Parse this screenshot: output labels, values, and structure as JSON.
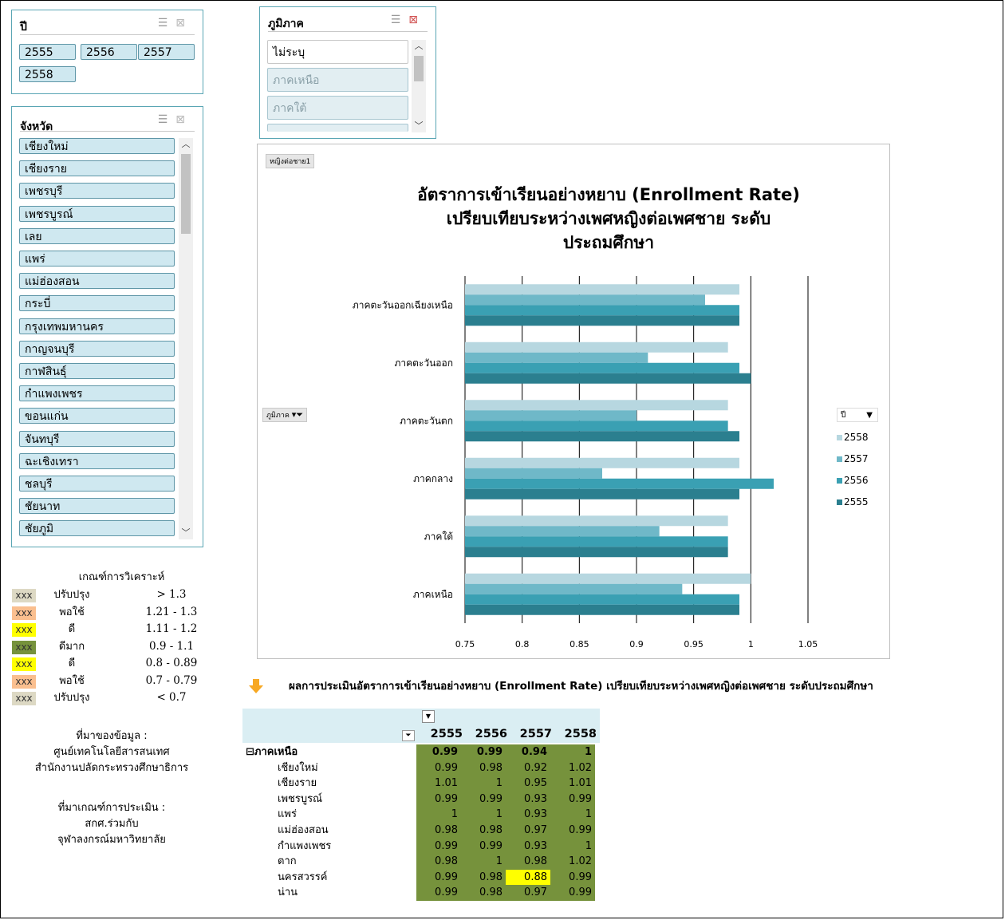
{
  "slicers": {
    "year": {
      "title": "ปี",
      "items": [
        "2555",
        "2556",
        "2557",
        "2558"
      ]
    },
    "region": {
      "title": "ภูมิภาค",
      "items": [
        "ไม่ระบุ",
        "ภาคเหนือ",
        "ภาคใต้"
      ]
    },
    "province": {
      "title": "จังหวัด",
      "items": [
        "เชียงใหม่",
        "เชียงราย",
        "เพชรบุรี",
        "เพชรบูรณ์",
        "เลย",
        "แพร่",
        "แม่ฮ่องสอน",
        "กระบี่",
        "กรุงเทพมหานคร",
        "กาญจนบุรี",
        "กาฬสินธุ์",
        "กำแพงเพชร",
        "ขอนแก่น",
        "จันทบุรี",
        "ฉะเชิงเทรา",
        "ชลบุรี",
        "ชัยนาท",
        "ชัยภูมิ"
      ]
    }
  },
  "criteria": {
    "title": "เกณฑ์การวิเคราะห์",
    "swatch_text": "xxx",
    "rows": [
      {
        "label": "ปรับปรุง",
        "range": "> 1.3",
        "color": "#ddd9c4"
      },
      {
        "label": "พอใช้",
        "range": "1.21 - 1.3",
        "color": "#fabf8f"
      },
      {
        "label": "ดี",
        "range": "1.11 - 1.2",
        "color": "#ffff00"
      },
      {
        "label": "ดีมาก",
        "range": "0.9 - 1.1",
        "color": "#76923c"
      },
      {
        "label": "ดี",
        "range": "0.8 - 0.89",
        "color": "#ffff00"
      },
      {
        "label": "พอใช้",
        "range": "0.7 - 0.79",
        "color": "#fabf8f"
      },
      {
        "label": "ปรับปรุง",
        "range": "< 0.7",
        "color": "#ddd9c4"
      }
    ]
  },
  "source": {
    "data_title": "ที่มาของข้อมูล :",
    "data_line1": "ศูนย์เทคโนโลยีสารสนเทศ",
    "data_line2": "สำนักงานปลัดกระทรวงศึกษาธิการ",
    "criteria_title": "ที่มาเกณฑ์การประเมิน :",
    "criteria_line1": "สกศ.ร่วมกับ",
    "criteria_line2": "จุฬาลงกรณ์มหาวิทยาลัย"
  },
  "chart": {
    "field_button_value": "หญิงต่อชาย1",
    "axis_field_button": "ภูมิภาค",
    "legend_field": "ปี"
  },
  "chart_data": {
    "type": "bar",
    "orientation": "horizontal",
    "title_lines": [
      "อัตราการเข้าเรียนอย่างหยาบ (Enrollment Rate)",
      "เปรียบเทียบระหว่างเพศหญิงต่อเพศชาย ระดับ",
      "ประถมศึกษา"
    ],
    "categories": [
      "ภาคตะวันออกเฉียงเหนือ",
      "ภาคตะวันออก",
      "ภาคตะวันตก",
      "ภาคกลาง",
      "ภาคใต้",
      "ภาคเหนือ"
    ],
    "series": [
      {
        "name": "2558",
        "color": "#b7d7e0",
        "values": [
          0.99,
          0.98,
          0.98,
          0.99,
          0.98,
          1.0
        ]
      },
      {
        "name": "2557",
        "color": "#6fb8c8",
        "values": [
          0.96,
          0.91,
          0.9,
          0.87,
          0.92,
          0.94
        ]
      },
      {
        "name": "2556",
        "color": "#3aa0b3",
        "values": [
          0.99,
          0.99,
          0.98,
          1.02,
          0.98,
          0.99
        ]
      },
      {
        "name": "2555",
        "color": "#2b7f8f",
        "values": [
          0.99,
          1.0,
          0.99,
          0.99,
          0.98,
          0.99
        ]
      }
    ],
    "xticks": [
      "0.75",
      "0.8",
      "0.85",
      "0.9",
      "0.95",
      "1",
      "1.05"
    ],
    "xlim": [
      0.75,
      1.05
    ],
    "grid": true,
    "legend_position": "right"
  },
  "section": {
    "heading": "ผลการประเมินอัตราการเข้าเรียนอย่างหยาบ (Enrollment Rate) เปรียบเทียบระหว่างเพศหญิงต่อเพศชาย ระดับประถมศึกษา"
  },
  "pivot": {
    "years": [
      "2555",
      "2556",
      "2557",
      "2558"
    ],
    "group": {
      "label": "ภาคเหนือ",
      "values": [
        "0.99",
        "0.99",
        "0.94",
        "1"
      ]
    },
    "rows": [
      {
        "label": "เชียงใหม่",
        "values": [
          "0.99",
          "0.98",
          "0.92",
          "1.02"
        ]
      },
      {
        "label": "เชียงราย",
        "values": [
          "1.01",
          "1",
          "0.95",
          "1.01"
        ]
      },
      {
        "label": "เพชรบูรณ์",
        "values": [
          "0.99",
          "0.99",
          "0.93",
          "0.99"
        ]
      },
      {
        "label": "แพร่",
        "values": [
          "1",
          "1",
          "0.93",
          "1"
        ]
      },
      {
        "label": "แม่ฮ่องสอน",
        "values": [
          "0.98",
          "0.98",
          "0.97",
          "0.99"
        ]
      },
      {
        "label": "กำแพงเพชร",
        "values": [
          "0.99",
          "0.99",
          "0.93",
          "1"
        ]
      },
      {
        "label": "ตาก",
        "values": [
          "0.98",
          "1",
          "0.98",
          "1.02"
        ]
      },
      {
        "label": "นครสวรรค์",
        "values": [
          "0.99",
          "0.98",
          "0.88",
          "0.99"
        ]
      },
      {
        "label": "น่าน",
        "values": [
          "0.99",
          "0.98",
          "0.97",
          "0.99"
        ]
      }
    ],
    "highlight": {
      "row": 7,
      "col": 2,
      "color": "#ffff00"
    }
  }
}
